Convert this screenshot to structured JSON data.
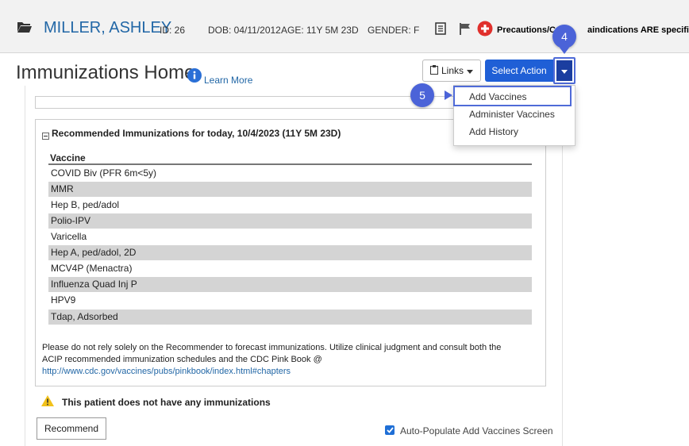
{
  "patient": {
    "name": "MILLER, ASHLEY",
    "id": "ID: 26",
    "dob": "DOB: 04/11/2012",
    "age": "AGE: 11Y 5M 23D",
    "gender": "GENDER: F",
    "precautions_left": "Precautions/C",
    "precautions_right": "aindications ARE specifiec"
  },
  "page": {
    "title": "Immunizations Home",
    "learn_more": "Learn More",
    "links_label": "Links",
    "select_action_label": "Select Action"
  },
  "steps": {
    "dropdown_step": "4",
    "menu_step": "5"
  },
  "dropdown": {
    "items": [
      "Add Vaccines",
      "Administer Vaccines",
      "Add History"
    ]
  },
  "recommended": {
    "title": "Recommended Immunizations for today, 10/4/2023 (11Y 5M 23D)",
    "column_header": "Vaccine",
    "vaccines": [
      "COVID Biv (PFR 6m<5y)",
      "MMR",
      "Hep B, ped/adol",
      "Polio-IPV",
      "Varicella",
      "Hep A, ped/adol, 2D",
      "MCV4P (Menactra)",
      "Influenza Quad Inj P",
      "HPV9",
      "Tdap, Adsorbed"
    ],
    "disclaimer_line1": "Please do not rely solely on the Recommender to forecast immunizations. Utilize clinical judgment and consult both the",
    "disclaimer_line2": "ACIP recommended immunization schedules and the CDC Pink Book @",
    "disclaimer_link": "http://www.cdc.gov/vaccines/pubs/pinkbook/index.html#chapters"
  },
  "footer": {
    "warning": "This patient does not have any immunizations",
    "recommend_button": "Recommend",
    "auto_populate_label": "Auto-Populate Add Vaccines Screen",
    "auto_populate_checked": true
  },
  "colors": {
    "primary_button": "#1f5fd6",
    "annotation": "#4b63d8",
    "link": "#2267a6",
    "row_shade": "#d4d4d4"
  }
}
